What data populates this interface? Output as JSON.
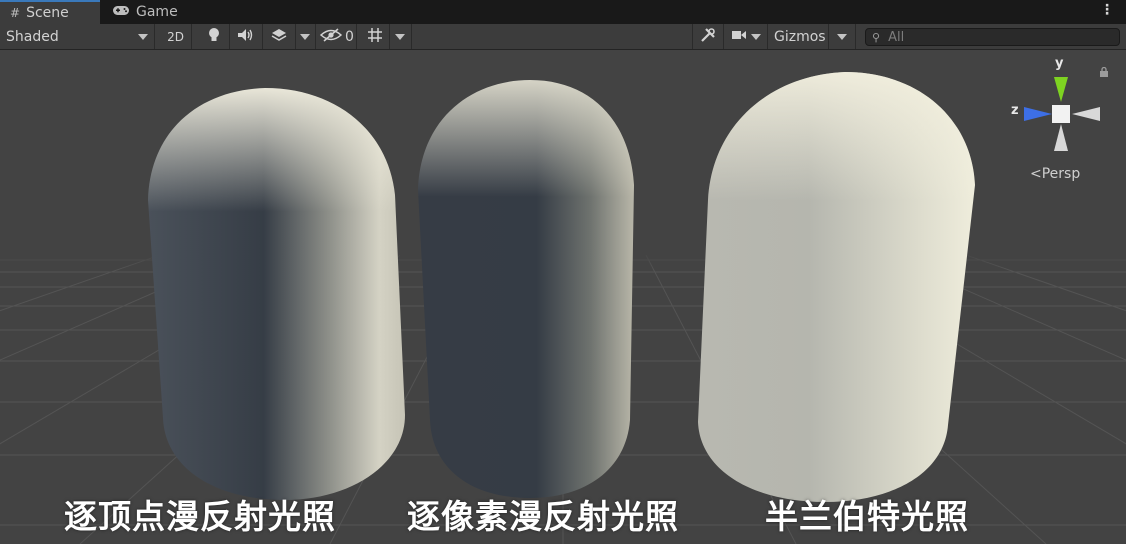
{
  "tabs": [
    {
      "label": "Scene",
      "icon": "grid-icon",
      "active": true
    },
    {
      "label": "Game",
      "icon": "gamepad-icon",
      "active": false
    }
  ],
  "toolbar": {
    "shading_mode": "Shaded",
    "mode_2d": "2D",
    "hidden_count": "0",
    "gizmos_label": "Gizmos",
    "search_placeholder": "All"
  },
  "gizmo": {
    "axis_y": "y",
    "axis_z": "z",
    "projection": "<Persp"
  },
  "captions": [
    "逐顶点漫反射光照",
    "逐像素漫反射光照",
    "半兰伯特光照"
  ],
  "colors": {
    "viewport_bg": "#434343",
    "capsule_dark": "#353c45",
    "capsule_light": "#f2efe0",
    "axis_y": "#7ed321",
    "axis_z": "#3d6fe6",
    "tab_accent": "#3a79bb"
  }
}
